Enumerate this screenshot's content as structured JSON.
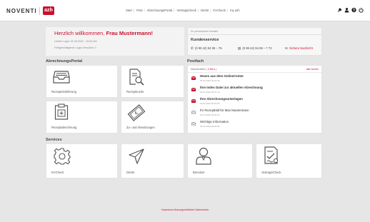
{
  "header": {
    "brand": "NOVENTI",
    "brand2": "azh",
    "nav": [
      "Start",
      "Post",
      "AbrechnungsPortal",
      "VertragsCheck",
      "Direkt",
      "KVCheck",
      "my azh"
    ]
  },
  "welcome": {
    "greeting": "Herzlich willkommen, ",
    "name": "Frau Mustermann!",
    "last_login": "Letzter Login: 01.03.2020 - 10:00 Uhr",
    "failed_login": "Fehlgeschlagener Login-Versuche: 0"
  },
  "kontakt": {
    "header": "Ihr persönlicher Kontakt",
    "title": "Kundenservice",
    "phone": "(0 99 42) 94 08 – 75",
    "fax": "(0 99 42) 94 08 – 7 72",
    "message": "Sichere Nachricht"
  },
  "abrechnung": {
    "title": "AbrechnungsPortal",
    "tiles": [
      "Rezepteinlieferung",
      "Rezeptsuche",
      "Rezeptabrechnung",
      "Zu- und Absetzungen"
    ]
  },
  "postfach": {
    "title": "Postfach",
    "header_prefix": "Nachrichten ( ",
    "new_count": "3 Neu",
    "header_suffix": " )",
    "all_link": "alle sehen",
    "messages": [
      {
        "subject": "Heues aus dem OnlineCenter",
        "date": "03.02.2020 09:22:38",
        "unread": true
      },
      {
        "subject": "Ihre Index Datei zur aktuellen Abrechnung",
        "date": "03.02.2020 09:21:14",
        "unread": true
      },
      {
        "subject": "Ihre Abrechnungsunterlagen",
        "date": "03.02.2020 09:20:56",
        "unread": true
      },
      {
        "subject": "Ihr Rezeptbild für Max Mustermann",
        "date": "03.02.2020 09:20:22",
        "unread": false
      },
      {
        "subject": "Wichtige Information",
        "date": "03.02.2020 09:20:09",
        "unread": false
      }
    ]
  },
  "services": {
    "title": "Services",
    "tiles": [
      "KVCheck",
      "Direkt",
      "Benutzer",
      "VertragsCheck"
    ]
  },
  "footer": "Impressum Nutzungsrichtlinien Datenschutz",
  "colors": {
    "accent": "#c8102e",
    "background": "#e6e6e6",
    "tile": "#ffffff"
  }
}
